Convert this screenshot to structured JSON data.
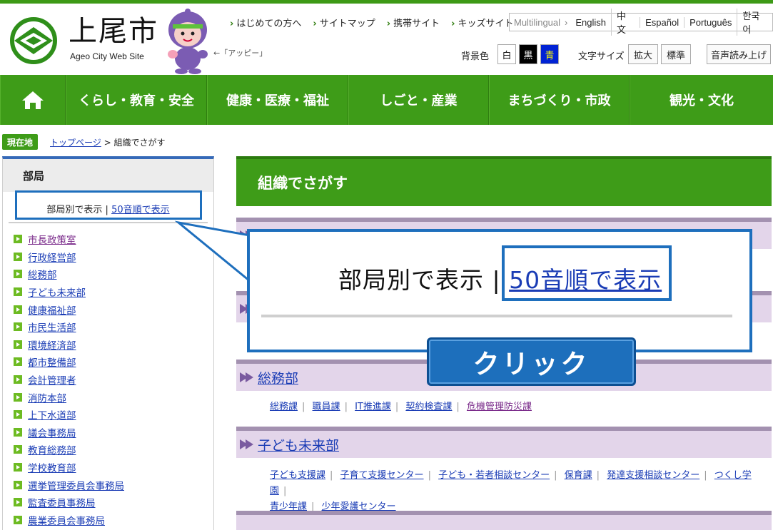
{
  "header": {
    "site_name": "上尾市",
    "site_sub": "Ageo City Web Site",
    "mascot_caption": "←「アッピー」",
    "top_links": [
      "はじめての方へ",
      "サイトマップ",
      "携帯サイト",
      "キッズサイト"
    ],
    "lang_label": "Multilingual",
    "languages": [
      "English",
      "中文",
      "Español",
      "Português",
      "한국어"
    ],
    "bgcolor_label": "背景色",
    "bgcolors": [
      "白",
      "黒",
      "青"
    ],
    "fontsize_label": "文字サイズ",
    "fontsize_enlarge": "拡大",
    "fontsize_standard": "標準",
    "voice": "音声読み上げ"
  },
  "nav": {
    "items": [
      "くらし・教育・安全",
      "健康・医療・福祉",
      "しごと・産業",
      "まちづくり・市政",
      "観光・文化"
    ]
  },
  "breadcrumb": {
    "label": "現在地",
    "top": "トップページ",
    "separator": ">",
    "current": "組織でさがす"
  },
  "sidebar": {
    "title": "部局",
    "toggle_by_dept": "部局別で表示",
    "toggle_sep": "|",
    "toggle_kana": "50音順で表示",
    "items": [
      "市長政策室",
      "行政経営部",
      "総務部",
      "子ども未来部",
      "健康福祉部",
      "市民生活部",
      "環境経済部",
      "都市整備部",
      "会計管理者",
      "消防本部",
      "上下水道部",
      "議会事務局",
      "教育総務部",
      "学校教育部",
      "選挙管理委員会事務局",
      "監査委員事務局",
      "農業委員会事務局"
    ]
  },
  "main": {
    "title": "組織でさがす",
    "sections": [
      {
        "name": "総務部",
        "links": [
          "総務課",
          "職員課",
          "IT推進課",
          "契約検査課",
          "危機管理防災課"
        ]
      },
      {
        "name": "子ども未来部",
        "links": [
          "子ども支援課",
          "子育て支援センター",
          "子ども・若者相談センター",
          "保育課",
          "発達支援相談センター",
          "つくし学園",
          "青少年課",
          "少年愛護センター"
        ]
      }
    ]
  },
  "callout": {
    "by_dept": "部局別で表示",
    "sep": "|",
    "kana": "50音順で表示",
    "click": "クリック"
  },
  "colors": {
    "green": "#3e9c18",
    "callout_blue": "#1e6fbd",
    "section_purple": "#e3d5ea"
  }
}
